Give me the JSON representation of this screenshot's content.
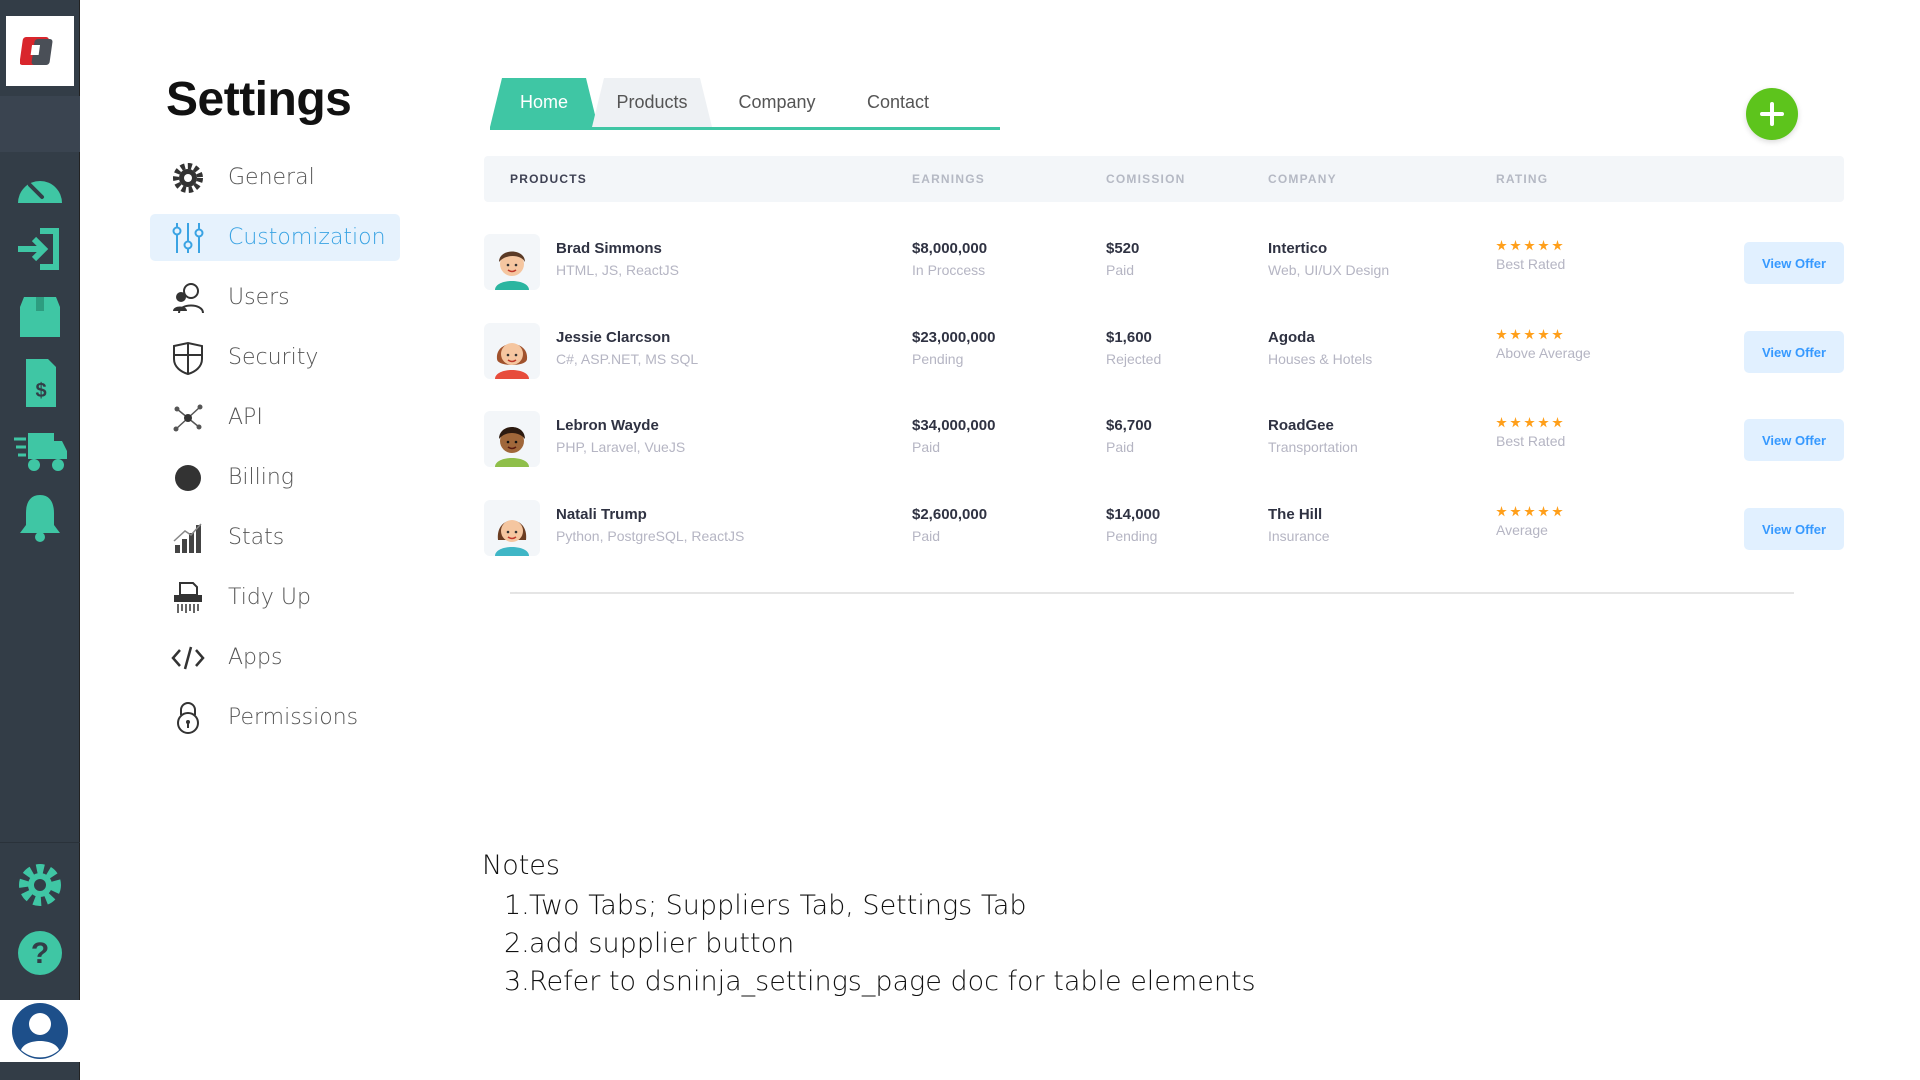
{
  "rail": {
    "icons": [
      "logo-icon",
      "dashboard-icon",
      "login-icon",
      "package-icon",
      "invoice-icon",
      "delivery-truck-icon",
      "bell-icon",
      "gear-icon",
      "help-icon",
      "user-avatar-icon"
    ]
  },
  "settings": {
    "title": "Settings",
    "menu": [
      {
        "label": "General",
        "icon": "gear-icon"
      },
      {
        "label": "Customization",
        "icon": "sliders-icon",
        "active": true
      },
      {
        "label": "Users",
        "icon": "users-icon"
      },
      {
        "label": "Security",
        "icon": "shield-icon"
      },
      {
        "label": "API",
        "icon": "network-icon"
      },
      {
        "label": "Billing",
        "icon": "circle-icon"
      },
      {
        "label": "Stats",
        "icon": "bar-chart-icon"
      },
      {
        "label": "Tidy Up",
        "icon": "shredder-icon"
      },
      {
        "label": "Apps",
        "icon": "code-icon"
      },
      {
        "label": "Permissions",
        "icon": "lock-icon"
      }
    ]
  },
  "tabs": [
    {
      "label": "Home",
      "active": true
    },
    {
      "label": "Products"
    },
    {
      "label": "Company"
    },
    {
      "label": "Contact"
    }
  ],
  "add_button": {
    "icon": "plus-icon",
    "color": "#5dc41c"
  },
  "table": {
    "headers": [
      "PRODUCTS",
      "EARNINGS",
      "COMISSION",
      "COMPANY",
      "RATING"
    ],
    "rows": [
      {
        "name": "Brad Simmons",
        "skills": "HTML, JS, ReactJS",
        "earnings": "$8,000,000",
        "earnings_status": "In Proccess",
        "commission": "$520",
        "commission_status": "Paid",
        "company": "Intertico",
        "company_type": "Web, UI/UX Design",
        "rating": 5,
        "rating_label": "Best Rated",
        "action": "View Offer"
      },
      {
        "name": "Jessie Clarcson",
        "skills": "C#, ASP.NET, MS SQL",
        "earnings": "$23,000,000",
        "earnings_status": "Pending",
        "commission": "$1,600",
        "commission_status": "Rejected",
        "company": "Agoda",
        "company_type": "Houses & Hotels",
        "rating": 5,
        "rating_label": "Above Average",
        "action": "View Offer"
      },
      {
        "name": "Lebron Wayde",
        "skills": "PHP, Laravel, VueJS",
        "earnings": "$34,000,000",
        "earnings_status": "Paid",
        "commission": "$6,700",
        "commission_status": "Paid",
        "company": "RoadGee",
        "company_type": "Transportation",
        "rating": 5,
        "rating_label": "Best Rated",
        "action": "View Offer"
      },
      {
        "name": "Natali Trump",
        "skills": "Python, PostgreSQL, ReactJS",
        "earnings": "$2,600,000",
        "earnings_status": "Paid",
        "commission": "$14,000",
        "commission_status": "Pending",
        "company": "The Hill",
        "company_type": "Insurance",
        "rating": 5,
        "rating_label": "Average",
        "action": "View Offer"
      }
    ]
  },
  "notes": {
    "title": "Notes",
    "items": [
      "Two Tabs; Suppliers Tab, Settings Tab",
      "add supplier button",
      "Refer to dsninja_settings_page doc for table elements"
    ]
  },
  "colors": {
    "accent": "#3fc6a4",
    "rail": "#333d47",
    "active_menu": "#3aa3e3",
    "star": "#ff9f1a",
    "offer_button": "#3699ff"
  }
}
